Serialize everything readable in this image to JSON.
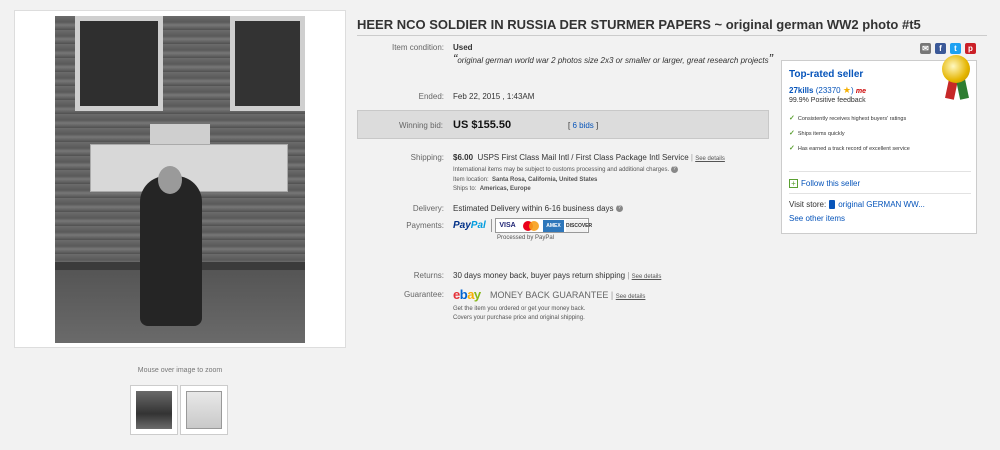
{
  "title": "HEER NCO SOLDIER IN RUSSIA DER STURMER PAPERS ~ original german WW2 photo #t5",
  "gallery": {
    "zoom_hint": "Mouse over image to zoom"
  },
  "share": {
    "mail": "✉",
    "facebook": "f",
    "twitter": "t",
    "pinterest": "p"
  },
  "condition": {
    "label": "Item condition:",
    "value": "Used",
    "open_quote": "“",
    "note": "original german world war 2 photos size 2x3 or smaller or larger, great research projects",
    "close_quote": "”"
  },
  "ended": {
    "label": "Ended:",
    "value": "Feb 22, 2015 , 1:43AM"
  },
  "bid": {
    "label": "Winning bid:",
    "price": "US $155.50",
    "count_open": "[ ",
    "count": "6 bids",
    "count_close": " ]"
  },
  "shipping": {
    "label": "Shipping:",
    "price": "$6.00",
    "service": "USPS First Class Mail Intl / First Class Package Intl Service",
    "see_details": "See details",
    "customs_note": "International items may be subject to customs processing and additional charges.",
    "location_label": "Item location:",
    "location": "Santa Rosa, California, United States",
    "ships_to_label": "Ships to:",
    "ships_to": "Americas, Europe"
  },
  "delivery": {
    "label": "Delivery:",
    "value": "Estimated Delivery within 6-16 business days"
  },
  "payments": {
    "label": "Payments:",
    "paypal_a": "Pay",
    "paypal_b": "Pal",
    "visa": "VISA",
    "amex": "AMEX",
    "discover": "DISCOVER",
    "note": "Processed by PayPal"
  },
  "returns": {
    "label": "Returns:",
    "value": "30 days money back, buyer pays return shipping",
    "see_details": "See details"
  },
  "guarantee": {
    "label": "Guarantee:",
    "logo_e": "e",
    "logo_b": "b",
    "logo_a": "a",
    "logo_y": "y",
    "name": "MONEY BACK GUARANTEE",
    "see_details": "See details",
    "line1": "Get the item you ordered or get your money back.",
    "line2": "Covers your purchase price and original shipping."
  },
  "seller": {
    "badge_title": "Top-rated seller",
    "name": "27kills",
    "score": "(23370",
    "score_close": ")",
    "me_label": "me",
    "feedback": "99.9% Positive feedback",
    "bullets": [
      "Consistently receives highest buyers' ratings",
      "Ships items quickly",
      "Has earned a track record of excellent service"
    ],
    "follow": "Follow this seller",
    "visit_label": "Visit store:",
    "store_name": "original GERMAN WW...",
    "other_items": "See other items"
  }
}
